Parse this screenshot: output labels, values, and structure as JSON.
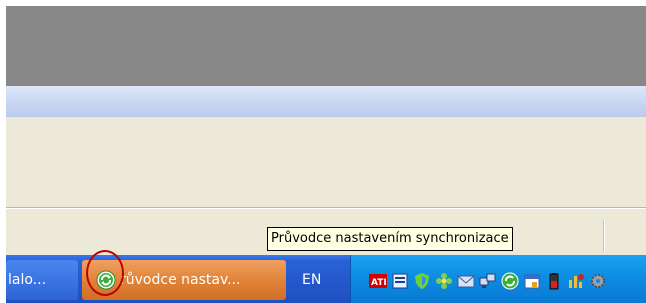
{
  "taskbar": {
    "buttons": [
      {
        "label": "lalo..."
      },
      {
        "label": "růvodce nastav..."
      }
    ],
    "language": "EN"
  },
  "tooltip": {
    "text": "Průvodce nastavením synchronizace"
  },
  "tray": {
    "icons": [
      "ati-icon",
      "notes-icon",
      "security-shield-icon",
      "flower-icon",
      "mail-icon",
      "network-icon",
      "sync-icon",
      "calendar-icon",
      "battery-icon",
      "chart-icon",
      "gear-icon"
    ]
  },
  "colors": {
    "taskbar_blue": "#2459cc",
    "active_task_orange": "#e0843a",
    "tray_blue": "#0c8be0",
    "annotation_red": "#c00000",
    "tooltip_bg": "#ffffe1"
  }
}
